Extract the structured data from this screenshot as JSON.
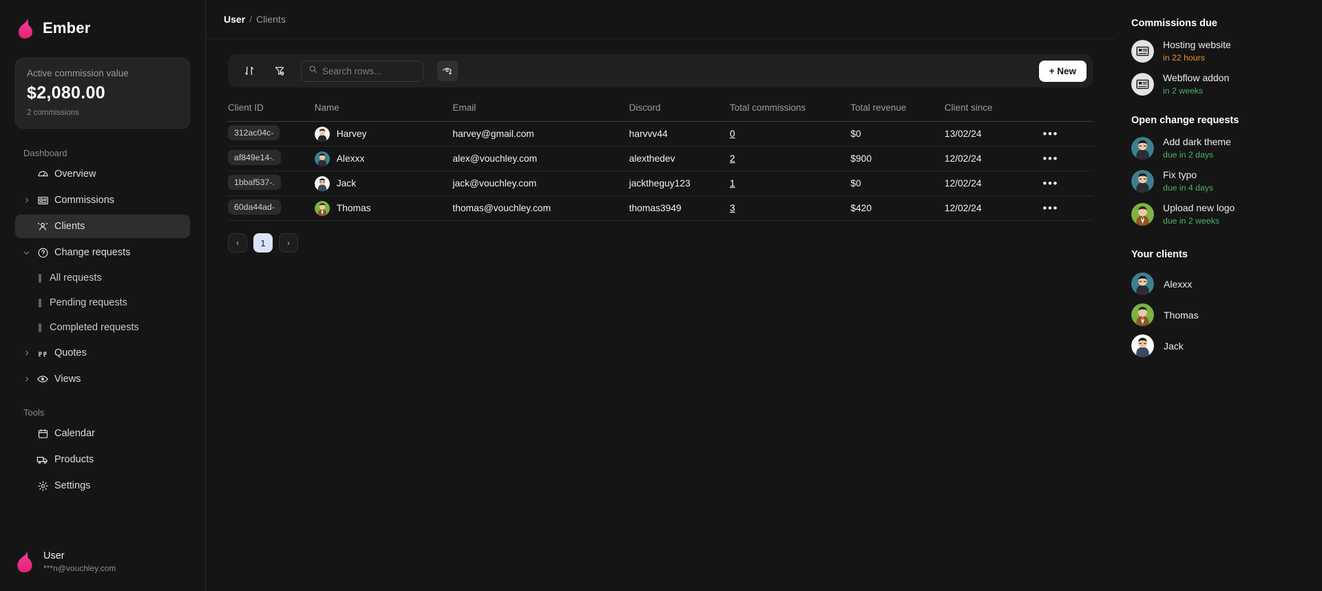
{
  "brand": {
    "name": "Ember",
    "logo_icon": "flame-icon"
  },
  "stat_card": {
    "label": "Active commission value",
    "value": "$2,080.00",
    "sub": "2 commissions"
  },
  "sidebar": {
    "sections": [
      {
        "title": "Dashboard"
      },
      {
        "title": "Tools"
      }
    ],
    "dashboard_items": [
      {
        "label": "Overview",
        "icon": "gauge-icon",
        "caret": "",
        "active": false
      },
      {
        "label": "Commissions",
        "icon": "receipt-icon",
        "caret": "chevron-right-icon",
        "active": false
      },
      {
        "label": "Clients",
        "icon": "users-icon",
        "caret": "",
        "active": true
      },
      {
        "label": "Change requests",
        "icon": "question-circle-icon",
        "caret": "chevron-down-icon",
        "active": false
      }
    ],
    "change_request_children": [
      {
        "label": "All requests"
      },
      {
        "label": "Pending requests"
      },
      {
        "label": "Completed requests"
      }
    ],
    "dashboard_items_tail": [
      {
        "label": "Quotes",
        "icon": "quote-icon",
        "caret": "chevron-right-icon",
        "active": false
      },
      {
        "label": "Views",
        "icon": "eye-icon",
        "caret": "chevron-right-icon",
        "active": false
      }
    ],
    "tools_items": [
      {
        "label": "Calendar",
        "icon": "calendar-icon"
      },
      {
        "label": "Products",
        "icon": "truck-icon"
      },
      {
        "label": "Settings",
        "icon": "gear-icon"
      }
    ],
    "footer": {
      "name": "User",
      "email": "***n@vouchley.com",
      "avatar": "flame-icon"
    }
  },
  "breadcrumb": {
    "root": "User",
    "separator": "/",
    "page": "Clients"
  },
  "toolbar": {
    "sort_icon": "sort-arrows-icon",
    "filter_icon": "filter-off-icon",
    "search_placeholder": "Search rows...",
    "search_value": "",
    "search_icon": "search-icon",
    "visibility_icon": "eye-plus-icon",
    "new_label": "+ New"
  },
  "table": {
    "columns": [
      "Client ID",
      "Name",
      "Email",
      "Discord",
      "Total commissions",
      "Total revenue",
      "Client since"
    ],
    "rows": [
      {
        "client_id": "312ac04c-",
        "name": "Harvey",
        "email": "harvey@gmail.com",
        "discord": "harvvv44",
        "total_commissions": "0",
        "total_revenue": "$0",
        "client_since": "13/02/24",
        "avatar_bg": "#f2f2f2",
        "avatar_hair": "#1c1c1c",
        "avatar_shirt": "#23272b"
      },
      {
        "client_id": "af849e14-.",
        "name": "Alexxx",
        "email": "alex@vouchley.com",
        "discord": "alexthedev",
        "total_commissions": "2",
        "total_revenue": "$900",
        "client_since": "12/02/24",
        "avatar_bg": "#3d7f91",
        "avatar_hair": "#17181a",
        "avatar_shirt": "#2a2d32"
      },
      {
        "client_id": "1bbaf537-.",
        "name": "Jack",
        "email": "jack@vouchley.com",
        "discord": "jacktheguy123",
        "total_commissions": "1",
        "total_revenue": "$0",
        "client_since": "12/02/24",
        "avatar_bg": "#fafafa",
        "avatar_hair": "#17181a",
        "avatar_shirt": "#3a4a63"
      },
      {
        "client_id": "60da44ad-",
        "name": "Thomas",
        "email": "thomas@vouchley.com",
        "discord": "thomas3949",
        "total_commissions": "3",
        "total_revenue": "$420",
        "client_since": "12/02/24",
        "avatar_bg": "#7cb342",
        "avatar_hair": "#1d2b12",
        "avatar_shirt": "#8d5524"
      }
    ]
  },
  "pagination": {
    "prev": "‹",
    "current": "1",
    "next": "›"
  },
  "right_panel": {
    "commissions_due": {
      "title": "Commissions due",
      "items": [
        {
          "title": "Hosting website",
          "due": "in 22 hours",
          "due_color": "#e8912a",
          "icon": "receipt-icon"
        },
        {
          "title": "Webflow addon",
          "due": "in 2 weeks",
          "due_color": "#4caf6d",
          "icon": "receipt-icon"
        }
      ]
    },
    "open_change_requests": {
      "title": "Open change requests",
      "items": [
        {
          "title": "Add dark theme",
          "due": "due in 2 days",
          "due_color": "#4caf6d",
          "avatar_bg": "#3d7f91",
          "avatar_hair": "#17181a",
          "avatar_shirt": "#2a2d32"
        },
        {
          "title": "Fix typo",
          "due": "due in 4 days",
          "due_color": "#4caf6d",
          "avatar_bg": "#3d7f91",
          "avatar_hair": "#17181a",
          "avatar_shirt": "#2a2d32"
        },
        {
          "title": "Upload new logo",
          "due": "due in 2 weeks",
          "due_color": "#4caf6d",
          "avatar_bg": "#7cb342",
          "avatar_hair": "#1d2b12",
          "avatar_shirt": "#8d5524"
        }
      ]
    },
    "your_clients": {
      "title": "Your clients",
      "items": [
        {
          "name": "Alexxx",
          "avatar_bg": "#3d7f91",
          "avatar_hair": "#17181a",
          "avatar_shirt": "#2a2d32"
        },
        {
          "name": "Thomas",
          "avatar_bg": "#7cb342",
          "avatar_hair": "#1d2b12",
          "avatar_shirt": "#8d5524"
        },
        {
          "name": "Jack",
          "avatar_bg": "#fafafa",
          "avatar_hair": "#17181a",
          "avatar_shirt": "#3a4a63"
        }
      ]
    }
  },
  "colors": {
    "brand": "#ec3f8e",
    "accent_page": "#d9e2f8",
    "warning": "#e8912a",
    "success": "#4caf6d"
  }
}
